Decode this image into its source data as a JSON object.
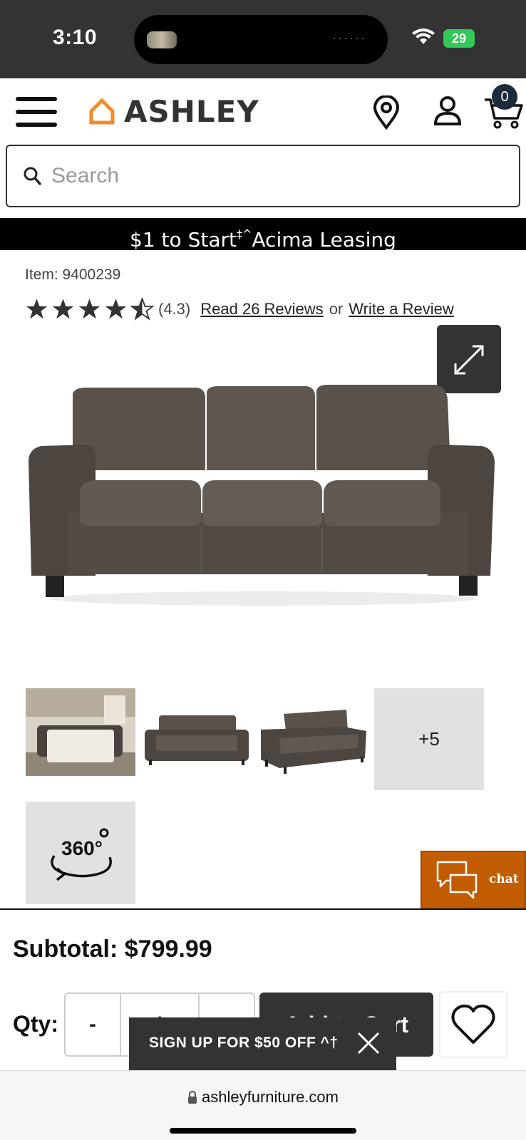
{
  "status_bar": {
    "time": "3:10",
    "battery": "29"
  },
  "header": {
    "logo_text": "ASHLEY",
    "cart_count": "0",
    "icons": [
      "menu-icon",
      "location-pin-icon",
      "account-icon",
      "cart-icon"
    ]
  },
  "search": {
    "placeholder": "Search"
  },
  "promo": {
    "text_pre": "$1 to Start",
    "sup": "‡^",
    "text_post": "Acima Leasing"
  },
  "product": {
    "item_number": "Item: 9400239",
    "rating": 4.3,
    "rating_text": "(4.3)",
    "read_reviews": "Read 26 Reviews",
    "or_text": "or",
    "write_review": "Write a Review",
    "more_images": "+5",
    "view_360": "360°"
  },
  "chat": {
    "label": "chat"
  },
  "cart_bar": {
    "subtotal": "Subtotal: $799.99",
    "qty_label": "Qty:",
    "minus": "-",
    "qty_value": "1",
    "add_to_cart": "Add to Cart"
  },
  "signup": {
    "text": "SIGN UP FOR $50 OFF ^†"
  },
  "browser": {
    "url": "ashleyfurniture.com"
  },
  "colors": {
    "accent_orange": "#c25c00",
    "logo_orange": "#f28c28",
    "dark": "#333333"
  }
}
